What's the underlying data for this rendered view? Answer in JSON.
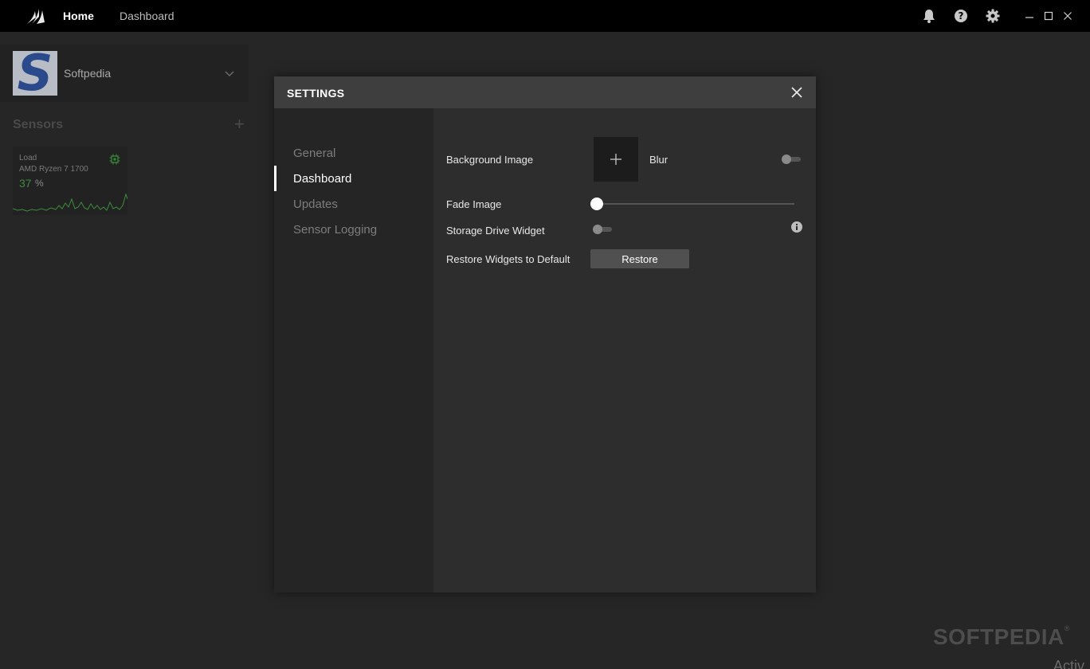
{
  "titlebar": {
    "nav": [
      "Home",
      "Dashboard"
    ]
  },
  "profile": {
    "name": "Softpedia",
    "avatar_letter": "S"
  },
  "sensors": {
    "title": "Sensors",
    "add": "+",
    "card": {
      "label": "Load",
      "device": "AMD Ryzen 7 1700",
      "value": "37",
      "unit": "%"
    }
  },
  "settings": {
    "title": "SETTINGS",
    "nav": [
      "General",
      "Dashboard",
      "Updates",
      "Sensor Logging"
    ],
    "active_nav": "Dashboard",
    "rows": {
      "background_image": "Background Image",
      "blur": "Blur",
      "blur_on": false,
      "fade_image": "Fade Image",
      "fade_value": 0,
      "storage_widget": "Storage Drive Widget",
      "storage_widget_on": false,
      "restore_label": "Restore Widgets to Default",
      "restore_button": "Restore"
    }
  },
  "watermark": "SOFTPEDIA",
  "watermark_mark": "®",
  "overlay_text": "Activ",
  "colors": {
    "accent_green": "#3c8c3c",
    "titlebar_bg": "#000000",
    "modal_bg": "#2d2d2d"
  }
}
